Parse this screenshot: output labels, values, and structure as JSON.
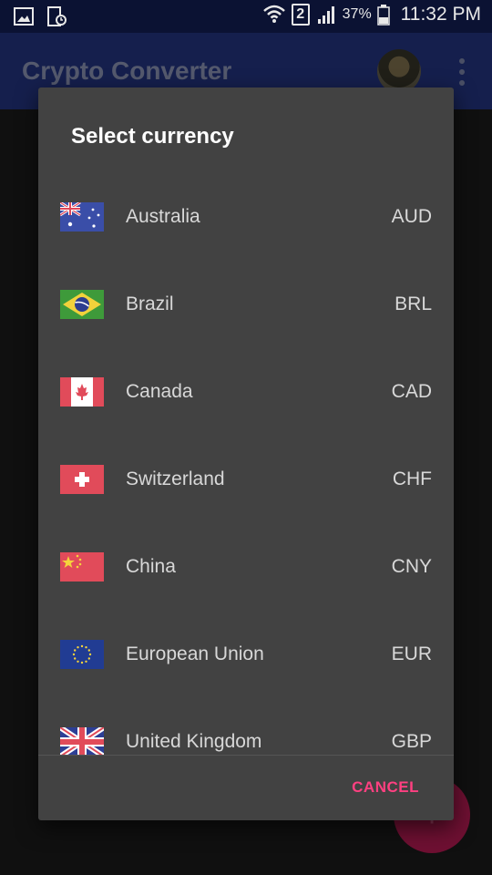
{
  "status_bar": {
    "time": "11:32 PM",
    "battery_percent": "37%",
    "sim_slot": "2",
    "icons": [
      "gallery-icon",
      "screenshot-icon",
      "wifi-icon",
      "sim-2-icon",
      "signal-icon",
      "battery-icon"
    ]
  },
  "app_bar": {
    "title": "Crypto Converter",
    "overflow_icon": "more-vert-icon"
  },
  "dialog": {
    "title": "Select currency",
    "cancel_label": "CANCEL",
    "items": [
      {
        "country": "Australia",
        "code": "AUD",
        "flag_icon": "australia-flag-icon"
      },
      {
        "country": "Brazil",
        "code": "BRL",
        "flag_icon": "brazil-flag-icon"
      },
      {
        "country": "Canada",
        "code": "CAD",
        "flag_icon": "canada-flag-icon"
      },
      {
        "country": "Switzerland",
        "code": "CHF",
        "flag_icon": "switzerland-flag-icon"
      },
      {
        "country": "China",
        "code": "CNY",
        "flag_icon": "china-flag-icon"
      },
      {
        "country": "European Union",
        "code": "EUR",
        "flag_icon": "eu-flag-icon"
      },
      {
        "country": "United Kingdom",
        "code": "GBP",
        "flag_icon": "uk-flag-icon"
      }
    ]
  },
  "colors": {
    "app_bar": "#273a8c",
    "dialog_bg": "#424242",
    "accent": "#ff4081",
    "fab": "#6e1032"
  }
}
